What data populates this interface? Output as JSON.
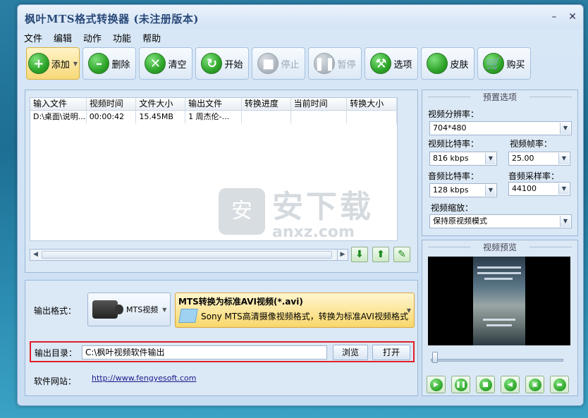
{
  "window": {
    "title": "枫叶MTS格式转换器  (未注册版本)"
  },
  "titlebar_buttons": [
    "–",
    "✕"
  ],
  "menu": [
    "文件",
    "编辑",
    "动作",
    "功能",
    "帮助"
  ],
  "toolbar": [
    {
      "label": "添加",
      "icon": "+",
      "state": "active",
      "dropdown": true
    },
    {
      "label": "删除",
      "icon": "–",
      "state": "normal"
    },
    {
      "label": "清空",
      "icon": "✕",
      "state": "normal"
    },
    {
      "label": "开始",
      "icon": "↻",
      "state": "normal"
    },
    {
      "label": "停止",
      "icon": "■",
      "state": "disabled"
    },
    {
      "label": "暂停",
      "icon": "❚❚",
      "state": "disabled"
    },
    {
      "label": "选项",
      "icon": "⚒",
      "state": "normal"
    },
    {
      "label": "皮肤",
      "icon": "",
      "state": "normal"
    },
    {
      "label": "购买",
      "icon": "🛒",
      "state": "normal"
    }
  ],
  "file_table": {
    "headers": [
      "输入文件",
      "视频时间",
      "文件大小",
      "输出文件",
      "转换进度",
      "当前时间",
      "转换大小"
    ],
    "rows": [
      [
        "D:\\桌面\\说明...",
        "00:00:42",
        "15.45MB",
        "1 周杰伦-...",
        "",
        "",
        ""
      ]
    ]
  },
  "watermark": {
    "line1": "安下载",
    "line2": "anxz.com",
    "badge": "安"
  },
  "output": {
    "format_label": "输出格式：",
    "format_button": "MTS视频",
    "format_title": "MTS转换为标准AVI视频(*.avi)",
    "format_desc": "Sony MTS高清摄像视频格式，转换为标准AVI视频格式",
    "dir_label": "输出目录：",
    "dir_value": "C:\\枫叶视频软件输出",
    "browse": "浏览",
    "open": "打开",
    "site_label": "软件网站：",
    "site_url": "http://www.fengyesoft.com"
  },
  "preset": {
    "title": "预置选项",
    "resolution_label": "视频分辨率：",
    "resolution": "704*480",
    "vbitrate_label": "视频比特率：",
    "vbitrate": "816 kbps",
    "framerate_label": "视频帧率：",
    "framerate": "25.00",
    "abitrate_label": "音频比特率：",
    "abitrate": "128 kbps",
    "samplerate_label": "音频采样率：",
    "samplerate": "44100",
    "scale_label": "视频缩放：",
    "scale": "保持原视频模式"
  },
  "preview": {
    "title": "视频预览"
  },
  "colors": {
    "accent_red": "#e0202a",
    "format_yellow": "#f8d76b",
    "green_icon": "#2ea52a"
  }
}
